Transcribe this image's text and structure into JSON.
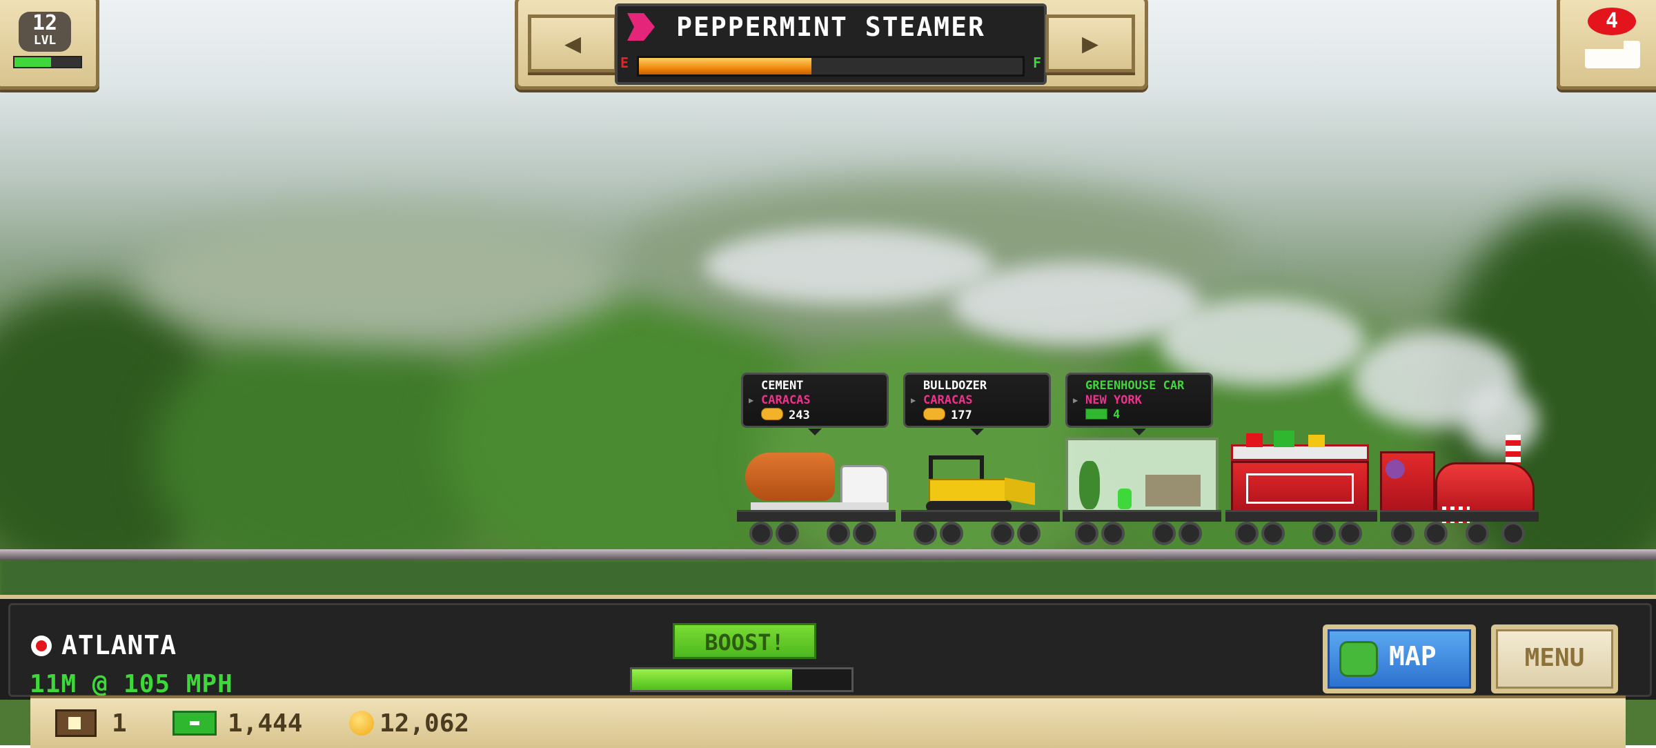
{
  "hud": {
    "level": "12",
    "level_label": "LVL",
    "level_progress": 0.55,
    "train_name": "PEPPERMINT STEAMER",
    "fuel_empty_label": "E",
    "fuel_full_label": "F",
    "fuel_level": 0.45,
    "car_count": "4"
  },
  "cargo": [
    {
      "name": "CEMENT",
      "destination": "CARACAS",
      "amount": "243",
      "type": "coin"
    },
    {
      "name": "BULLDOZER",
      "destination": "CARACAS",
      "amount": "177",
      "type": "coin"
    },
    {
      "name": "GREENHOUSE CAR",
      "destination": "NEW YORK",
      "amount": "4",
      "type": "cash"
    }
  ],
  "status": {
    "station": "ATLANTA",
    "speed": "11M @ 105 MPH",
    "boost_label": "BOOST!",
    "boost_level": 0.73,
    "map_label": "MAP",
    "menu_label": "MENU"
  },
  "resources": {
    "crates": "1",
    "cash": "1,444",
    "coins": "12,062"
  },
  "colors": {
    "accent_green": "#3ed83a",
    "destination_pink": "#f0318c",
    "fuel_orange": "#f08a10"
  }
}
